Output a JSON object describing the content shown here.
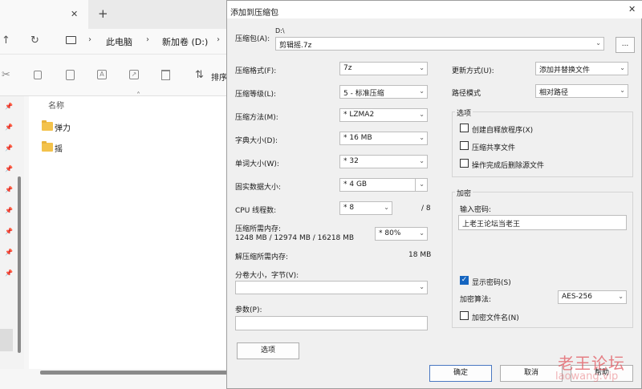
{
  "explorer": {
    "tab_close": "✕",
    "tab_add": "+",
    "breadcrumb": [
      "此电脑",
      "新加卷 (D:)"
    ],
    "sort_label": "排序",
    "column_name": "名称",
    "files": [
      "弹力",
      "摇"
    ]
  },
  "dialog": {
    "title": "添加到压缩包",
    "archive_label": "压缩包(A):",
    "archive_path": "D:\\",
    "archive_name": "剪辑摇.7z",
    "browse_label": "...",
    "format_label": "压缩格式(F):",
    "format_value": "7z",
    "level_label": "压缩等级(L):",
    "level_value": "5 - 标准压缩",
    "method_label": "压缩方法(M):",
    "method_value": "* LZMA2",
    "dict_label": "字典大小(D):",
    "dict_value": "* 16 MB",
    "word_label": "单词大小(W):",
    "word_value": "* 32",
    "solid_label": "固实数据大小:",
    "solid_value": "* 4 GB",
    "cpu_label": "CPU 线程数:",
    "cpu_value": "* 8",
    "cpu_total": "/ 8",
    "mem_comp_label": "压缩所需内存:",
    "mem_comp_value": "1248 MB / 12974 MB / 16218 MB",
    "mem_percent": "* 80%",
    "mem_decomp_label": "解压缩所需内存:",
    "mem_decomp_value": "18 MB",
    "split_label": "分卷大小，字节(V):",
    "split_value": "",
    "params_label": "参数(P):",
    "params_value": "",
    "options_btn": "选项",
    "update_label": "更新方式(U):",
    "update_value": "添加并替换文件",
    "pathmode_label": "路径模式",
    "pathmode_value": "相对路径",
    "options_group": "选项",
    "opt_sfx": "创建自释放程序(X)",
    "opt_shared": "压缩共享文件",
    "opt_delete": "操作完成后删除源文件",
    "encrypt_group": "加密",
    "pwd_label": "输入密码:",
    "pwd_value": "上老王论坛当老王",
    "show_pwd": "显示密码(S)",
    "enc_method_label": "加密算法:",
    "enc_method_value": "AES-256",
    "enc_names": "加密文件名(N)",
    "ok": "确定",
    "cancel": "取消",
    "help": "帮助"
  },
  "watermark": {
    "text": "老王论坛",
    "url": "laowang.vip"
  }
}
